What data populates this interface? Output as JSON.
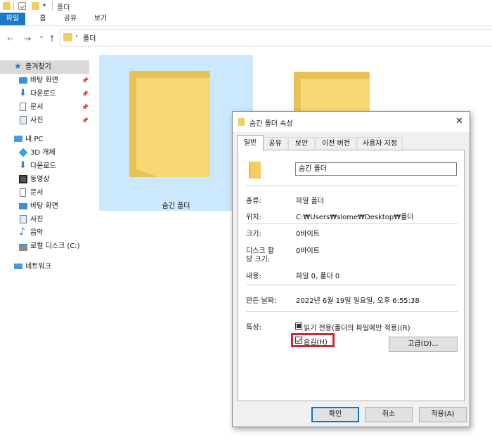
{
  "window": {
    "title": "폴더"
  },
  "ribbon": {
    "tabs": [
      "파일",
      "홈",
      "공유",
      "보기"
    ]
  },
  "address": {
    "path_item": "폴더",
    "separator": "›"
  },
  "nav": {
    "back": "←",
    "forward": "→",
    "recent": "⌄",
    "up": "↑"
  },
  "sidebar": {
    "quick_access": "즐겨찾기",
    "quick_items": [
      "바탕 화면",
      "다운로드",
      "문서",
      "사진"
    ],
    "this_pc": "내 PC",
    "pc_items": [
      "3D 개체",
      "다운로드",
      "동영상",
      "문서",
      "바탕 화면",
      "사진",
      "음악",
      "로컬 디스크 (C:)"
    ],
    "network": "네트워크"
  },
  "content": {
    "folder1_name": "숨긴 폴더"
  },
  "dialog": {
    "title": "숨긴 폴더 속성",
    "close": "✕",
    "tabs": [
      "일반",
      "공유",
      "보안",
      "이전 버전",
      "사용자 지정"
    ],
    "name_value": "숨긴 폴더",
    "type_label": "종류:",
    "type_value": "파일 폴더",
    "location_label": "위치:",
    "location_value": "C:₩Users₩slome₩Desktop₩폴더",
    "size_label": "크기:",
    "size_value": "0바이트",
    "disk_size_label_line1": "디스크 할",
    "disk_size_label_line2": "당 크기:",
    "disk_size_value": "0바이트",
    "contents_label": "내용:",
    "contents_value": "파일 0, 폴더 0",
    "created_label": "만든 날짜:",
    "created_value": "2022년 6월 19일 일요일, 오후 6:55:38",
    "attributes_label": "특성:",
    "readonly_label": "읽기 전용(폴더의 파일에만 적용)(R)",
    "hidden_label": "숨김(H)",
    "advanced_button": "고급(D)...",
    "ok_button": "확인",
    "cancel_button": "취소",
    "apply_button": "적용(A)"
  },
  "colors": {
    "accent": "#1979ca",
    "highlight_box": "#e0202a",
    "folder": "#f8d775",
    "selection": "#cce8ff"
  }
}
